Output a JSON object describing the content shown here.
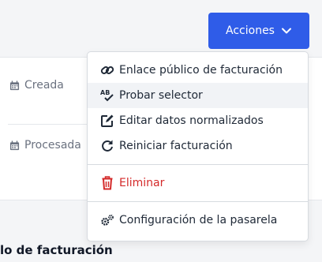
{
  "header": {
    "actions_label": "Acciones"
  },
  "details": {
    "created_label": "Creada",
    "processed_label": "Procesada"
  },
  "section": {
    "title_fragment": "lo de facturación"
  },
  "menu": {
    "items": [
      {
        "label": "Enlace público de facturación",
        "icon": "link-icon"
      },
      {
        "label": "Probar selector",
        "icon": "spellcheck-icon"
      },
      {
        "label": "Editar datos normalizados",
        "icon": "edit-icon"
      },
      {
        "label": "Reiniciar facturación",
        "icon": "redo-icon"
      },
      {
        "label": "Eliminar",
        "icon": "trash-icon"
      },
      {
        "label": "Configuración de la pasarela",
        "icon": "cogs-icon"
      }
    ]
  },
  "colors": {
    "primary": "#2f5ce8",
    "danger": "#d42a2a"
  }
}
